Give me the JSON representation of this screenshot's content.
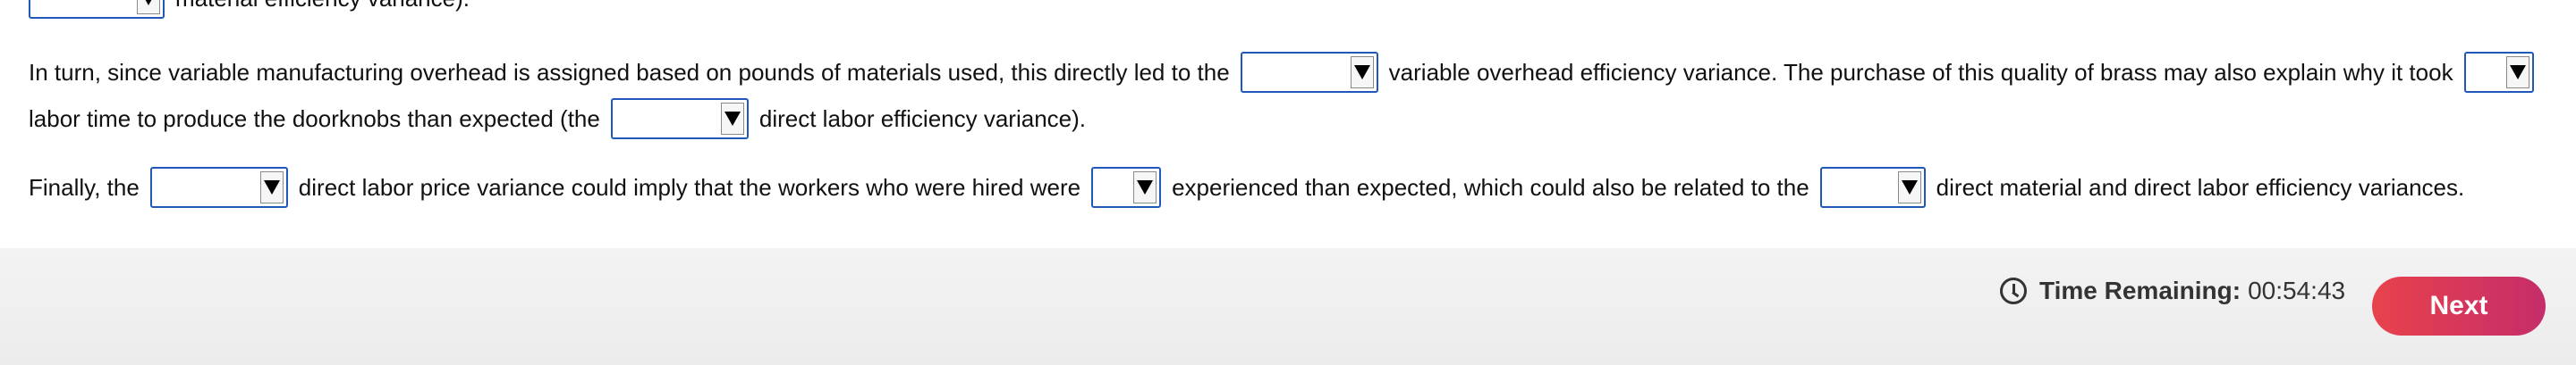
{
  "top_fragment": {
    "text": "material efficiency variance)."
  },
  "paragraph2": {
    "line1_a": "In turn, since variable manufacturing overhead is assigned based on pounds of materials used, this directly led to the",
    "line1_b": "variable overhead efficiency variance. The purchase of this quality of brass may also explain why it took",
    "line2_a": "labor time to produce the doorknobs than expected (the",
    "line2_b": "direct labor efficiency variance)."
  },
  "paragraph3": {
    "a": "Finally, the",
    "b": "direct labor price variance could imply that the workers who were hired were",
    "c": "experienced than expected, which could also be related to the",
    "d": "direct material and direct labor efficiency variances."
  },
  "dropdowns": {
    "selected_value": ""
  },
  "footer": {
    "time_label": "Time Remaining:",
    "time_value": "00:54:43",
    "next_label": "Next"
  },
  "colors": {
    "dropdown_border": "#1f58b8",
    "next_gradient_start": "#e8424c",
    "next_gradient_end": "#c52d6a"
  }
}
